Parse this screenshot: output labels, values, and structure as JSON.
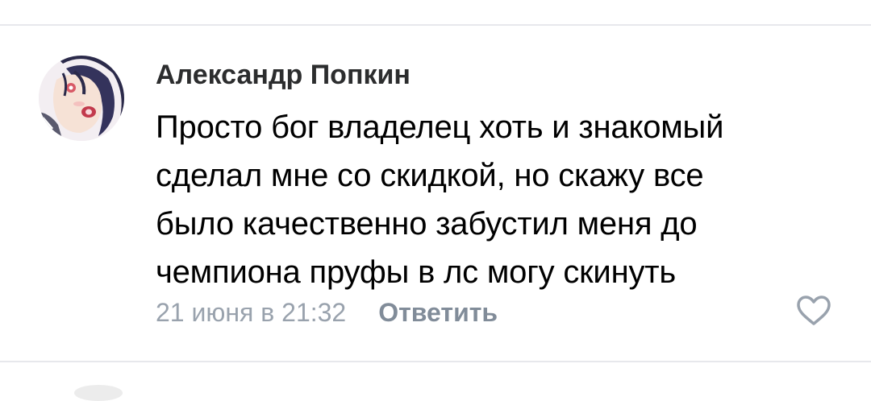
{
  "comment": {
    "author": "Александр Попкин",
    "text_lines": [
      "Просто бог владелец хоть и знакомый",
      "сделал мне со скидкой, но скажу все",
      "было качественно забустил меня до",
      "чемпиона пруфы в лс могу скинуть"
    ],
    "date": "21 июня в 21:32",
    "reply_label": "Ответить",
    "like_icon": "heart-outline-icon",
    "avatar_icon": "anime-girl-avatar"
  },
  "colors": {
    "author": "#2c2d2e",
    "text": "#000000",
    "date": "#99a2ad",
    "reply": "#818c99",
    "divider": "#e7e8ec",
    "like": "#99a2ad"
  }
}
